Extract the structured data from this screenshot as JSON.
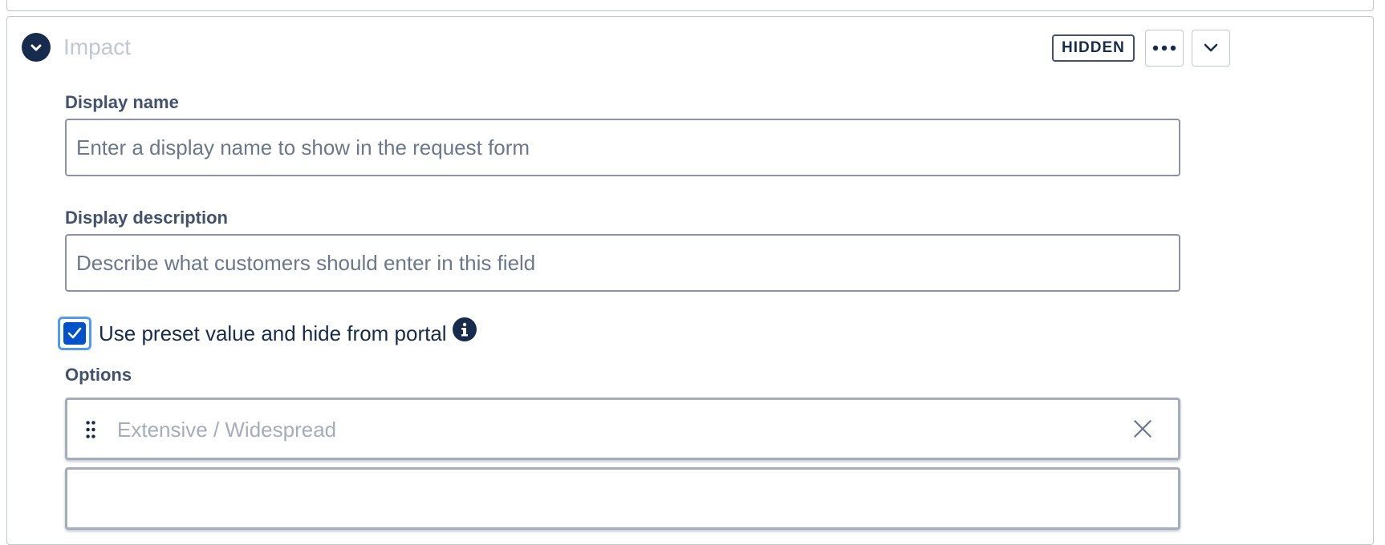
{
  "field": {
    "title": "Impact",
    "badge": "HIDDEN"
  },
  "form": {
    "display_name": {
      "label": "Display name",
      "placeholder": "Enter a display name to show in the request form",
      "value": ""
    },
    "display_description": {
      "label": "Display description",
      "placeholder": "Describe what customers should enter in this field",
      "value": ""
    },
    "preset_checkbox": {
      "label": "Use preset value and hide from portal",
      "checked": true
    },
    "options_label": "Options",
    "options": [
      {
        "placeholder": "Extensive / Widespread",
        "value": ""
      },
      {
        "placeholder": "",
        "value": ""
      }
    ]
  },
  "colors": {
    "accent": "#0052CC",
    "focus_ring": "#4C9AFF",
    "text": "#172B4D",
    "muted": "#C1C7D0"
  },
  "icons": {
    "collapse": "chevron-down-icon",
    "more": "more-icon",
    "expand": "chevron-down-icon",
    "info": "info-icon",
    "drag": "drag-handle-icon",
    "remove": "close-icon"
  }
}
